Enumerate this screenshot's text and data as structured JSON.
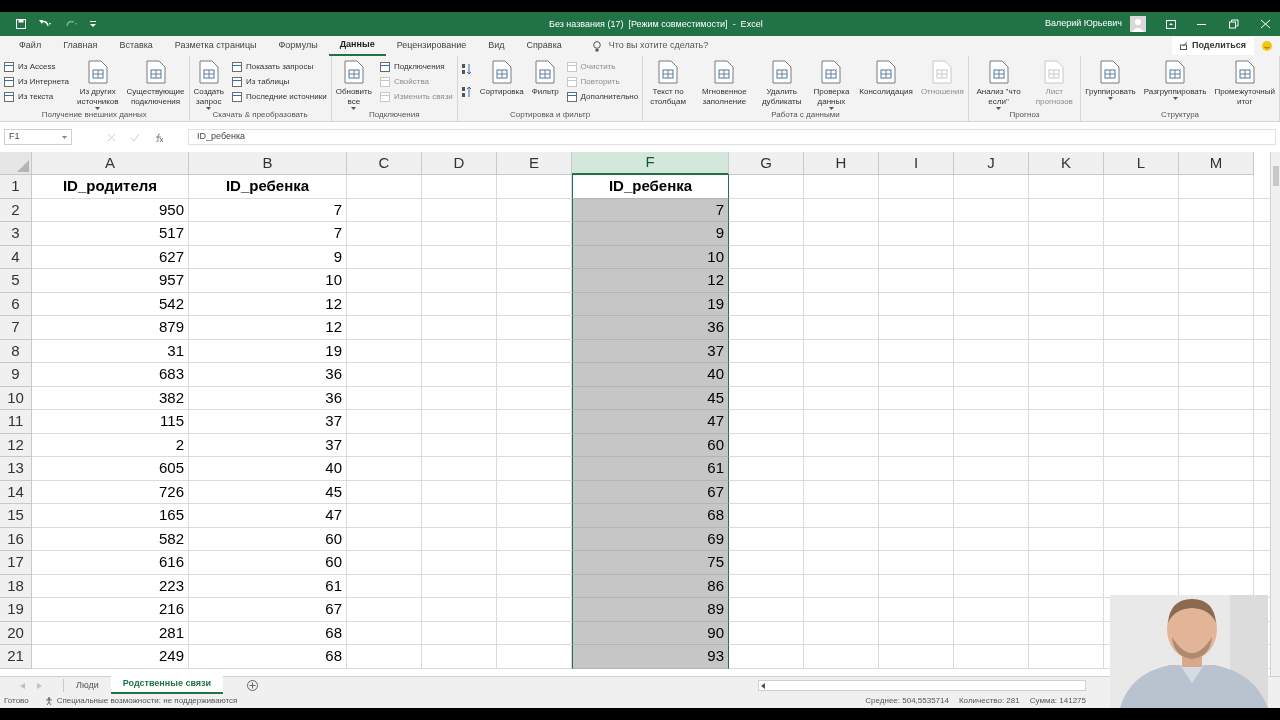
{
  "title_bar": {
    "title": "Без названия (17)  [Режим совместимости]  -  Excel",
    "user": "Валерий Юрьевич"
  },
  "menu_tabs": [
    {
      "label": "Файл",
      "selected": false
    },
    {
      "label": "Главная",
      "selected": false
    },
    {
      "label": "Вставка",
      "selected": false
    },
    {
      "label": "Разметка страницы",
      "selected": false
    },
    {
      "label": "Формулы",
      "selected": false
    },
    {
      "label": "Данные",
      "selected": true
    },
    {
      "label": "Рецензирование",
      "selected": false
    },
    {
      "label": "Вид",
      "selected": false
    },
    {
      "label": "Справка",
      "selected": false
    }
  ],
  "tell_me": {
    "placeholder": "Что вы хотите сделать?"
  },
  "share": {
    "label": "Поделиться"
  },
  "ribbon": {
    "groups": [
      {
        "label": "Получение внешних данных",
        "items": [
          {
            "kind": "stack",
            "items": [
              {
                "label": "Из Access",
                "disabled": false
              },
              {
                "label": "Из Интернета",
                "disabled": false
              },
              {
                "label": "Из текста",
                "disabled": false
              }
            ]
          },
          {
            "kind": "large",
            "label": "Из других источников",
            "dropdown": true,
            "disabled": false
          },
          {
            "kind": "large",
            "label": "Существующие подключения",
            "dropdown": false,
            "disabled": false
          }
        ]
      },
      {
        "label": "Скачать & преобразовать",
        "items": [
          {
            "kind": "large",
            "label": "Создать запрос",
            "dropdown": true,
            "disabled": false
          },
          {
            "kind": "stack",
            "items": [
              {
                "label": "Показать запросы",
                "disabled": false
              },
              {
                "label": "Из таблицы",
                "disabled": false
              },
              {
                "label": "Последние источники",
                "disabled": false
              }
            ]
          }
        ]
      },
      {
        "label": "Подключения",
        "items": [
          {
            "kind": "large",
            "label": "Обновить все",
            "dropdown": true,
            "disabled": false
          },
          {
            "kind": "stack",
            "items": [
              {
                "label": "Подключения",
                "disabled": false
              },
              {
                "label": "Свойства",
                "disabled": true
              },
              {
                "label": "Изменить связи",
                "disabled": true
              }
            ]
          }
        ]
      },
      {
        "label": "Сортировка и фильтр",
        "items": [
          {
            "kind": "sorticons"
          },
          {
            "kind": "large",
            "label": "Сортировка",
            "dropdown": false,
            "disabled": false
          },
          {
            "kind": "large",
            "label": "Фильтр",
            "dropdown": false,
            "disabled": false
          },
          {
            "kind": "stack",
            "items": [
              {
                "label": "Очистить",
                "disabled": true
              },
              {
                "label": "Повторить",
                "disabled": true
              },
              {
                "label": "Дополнительно",
                "disabled": false
              }
            ]
          }
        ]
      },
      {
        "label": "Работа с данными",
        "items": [
          {
            "kind": "large",
            "label": "Текст по столбцам",
            "dropdown": false,
            "disabled": false
          },
          {
            "kind": "large",
            "label": "Мгновенное заполнение",
            "dropdown": false,
            "disabled": false
          },
          {
            "kind": "large",
            "label": "Удалить дубликаты",
            "dropdown": false,
            "disabled": false
          },
          {
            "kind": "large",
            "label": "Проверка данных",
            "dropdown": true,
            "disabled": false
          },
          {
            "kind": "large",
            "label": "Консолидация",
            "dropdown": false,
            "disabled": false
          },
          {
            "kind": "large",
            "label": "Отношения",
            "dropdown": false,
            "disabled": true
          }
        ]
      },
      {
        "label": "Прогноз",
        "items": [
          {
            "kind": "large",
            "label": "Анализ \"что если\"",
            "dropdown": true,
            "disabled": false
          },
          {
            "kind": "large",
            "label": "Лист прогнозов",
            "dropdown": false,
            "disabled": true
          }
        ]
      },
      {
        "label": "Структура",
        "items": [
          {
            "kind": "large",
            "label": "Группировать",
            "dropdown": true,
            "disabled": false
          },
          {
            "kind": "large",
            "label": "Разгруппировать",
            "dropdown": true,
            "disabled": false
          },
          {
            "kind": "large",
            "label": "Промежуточный итог",
            "dropdown": false,
            "disabled": false
          }
        ]
      }
    ]
  },
  "formula_bar": {
    "name_box": "F1",
    "formula": "ID_ребенка"
  },
  "sheet": {
    "columns": [
      {
        "label": "A",
        "selected": false
      },
      {
        "label": "B",
        "selected": false
      },
      {
        "label": "C",
        "selected": false
      },
      {
        "label": "D",
        "selected": false
      },
      {
        "label": "E",
        "selected": false
      },
      {
        "label": "F",
        "selected": true
      },
      {
        "label": "G",
        "selected": false
      },
      {
        "label": "H",
        "selected": false
      },
      {
        "label": "I",
        "selected": false
      },
      {
        "label": "J",
        "selected": false
      },
      {
        "label": "K",
        "selected": false
      },
      {
        "label": "L",
        "selected": false
      },
      {
        "label": "M",
        "selected": false
      }
    ],
    "rows": [
      {
        "number": "1",
        "A": "ID_родителя",
        "B": "ID_ребенка",
        "F": "ID_ребенка"
      },
      {
        "number": "2",
        "A": "950",
        "B": "7",
        "F": "7"
      },
      {
        "number": "3",
        "A": "517",
        "B": "7",
        "F": "9"
      },
      {
        "number": "4",
        "A": "627",
        "B": "9",
        "F": "10"
      },
      {
        "number": "5",
        "A": "957",
        "B": "10",
        "F": "12"
      },
      {
        "number": "6",
        "A": "542",
        "B": "12",
        "F": "19"
      },
      {
        "number": "7",
        "A": "879",
        "B": "12",
        "F": "36"
      },
      {
        "number": "8",
        "A": "31",
        "B": "19",
        "F": "37"
      },
      {
        "number": "9",
        "A": "683",
        "B": "36",
        "F": "40"
      },
      {
        "number": "10",
        "A": "382",
        "B": "36",
        "F": "45"
      },
      {
        "number": "11",
        "A": "115",
        "B": "37",
        "F": "47"
      },
      {
        "number": "12",
        "A": "2",
        "B": "37",
        "F": "60"
      },
      {
        "number": "13",
        "A": "605",
        "B": "40",
        "F": "61"
      },
      {
        "number": "14",
        "A": "726",
        "B": "45",
        "F": "67"
      },
      {
        "number": "15",
        "A": "165",
        "B": "47",
        "F": "68"
      },
      {
        "number": "16",
        "A": "582",
        "B": "60",
        "F": "69"
      },
      {
        "number": "17",
        "A": "616",
        "B": "60",
        "F": "75"
      },
      {
        "number": "18",
        "A": "223",
        "B": "61",
        "F": "86"
      },
      {
        "number": "19",
        "A": "216",
        "B": "67",
        "F": "89"
      },
      {
        "number": "20",
        "A": "281",
        "B": "68",
        "F": "90"
      },
      {
        "number": "21",
        "A": "249",
        "B": "68",
        "F": "93"
      }
    ]
  },
  "sheet_tabs": [
    {
      "label": "Люди",
      "selected": false
    },
    {
      "label": "Родственные связи",
      "selected": true
    }
  ],
  "status_bar": {
    "ready": "Готово",
    "accessibility": "Специальные возможности: не поддерживаются",
    "average": "Среднее: 504,5535714",
    "count": "Количество: 281",
    "sum": "Сумма: 141275"
  }
}
